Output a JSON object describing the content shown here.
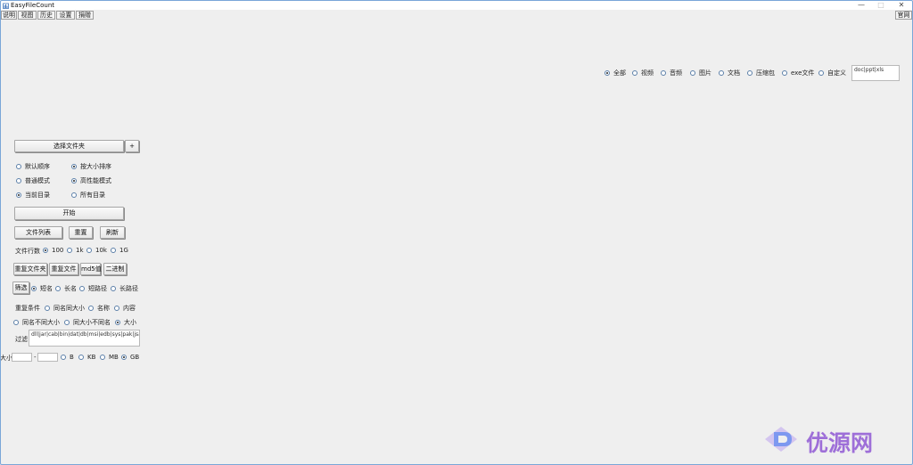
{
  "window": {
    "title": "EasyFileCount",
    "min": "—",
    "max": "□",
    "close": "✕"
  },
  "menu": [
    "说明",
    "视图",
    "历史",
    "设置",
    "捐赠"
  ],
  "website_button": "官网",
  "filetypes": {
    "options": [
      "全部",
      "视频",
      "音频",
      "图片",
      "文档",
      "压缩包",
      "exe文件",
      "自定义"
    ],
    "selected": 0,
    "custom_value": "doc|ppt|xls"
  },
  "select_folder_button": "选择文件夹",
  "add_button": "+",
  "sort": {
    "options": [
      "默认顺序",
      "按大小排序"
    ],
    "selected": 1
  },
  "mode": {
    "options": [
      "普通模式",
      "高性能模式"
    ],
    "selected": 1
  },
  "scope": {
    "options": [
      "当前目录",
      "所有目录"
    ],
    "selected": 0
  },
  "start_button": "开始",
  "file_list_button": "文件列表",
  "reset_button": "重置",
  "refresh_button": "刷新",
  "rows": {
    "label": "文件行数",
    "options": [
      "100",
      "1k",
      "10k",
      "1G"
    ],
    "selected": 0
  },
  "dup_buttons": [
    "重复文件夹",
    "重复文件",
    "md5值",
    "二进制"
  ],
  "filter_button": "筛选",
  "name_filter": {
    "options": [
      "短名",
      "长名",
      "短路径",
      "长路径"
    ],
    "selected": 0
  },
  "dup_condition": {
    "label": "重复条件",
    "options_row1": [
      "同名同大小",
      "名称",
      "内容"
    ],
    "options_row2": [
      "同名不同大小",
      "同大小不同名",
      "大小"
    ],
    "selected_row2": 2
  },
  "filter": {
    "label": "过滤",
    "value": "dll|jar|cab|bin|dat|db|msi|edb|sys|pak|jsa"
  },
  "size": {
    "label": "大小",
    "separator": "-",
    "min": "",
    "max": "",
    "units": [
      "B",
      "KB",
      "MB",
      "GB"
    ],
    "selected": 3
  },
  "watermark": {
    "text": "优源网"
  },
  "colors": {
    "watermark": "#9e6fd8"
  }
}
